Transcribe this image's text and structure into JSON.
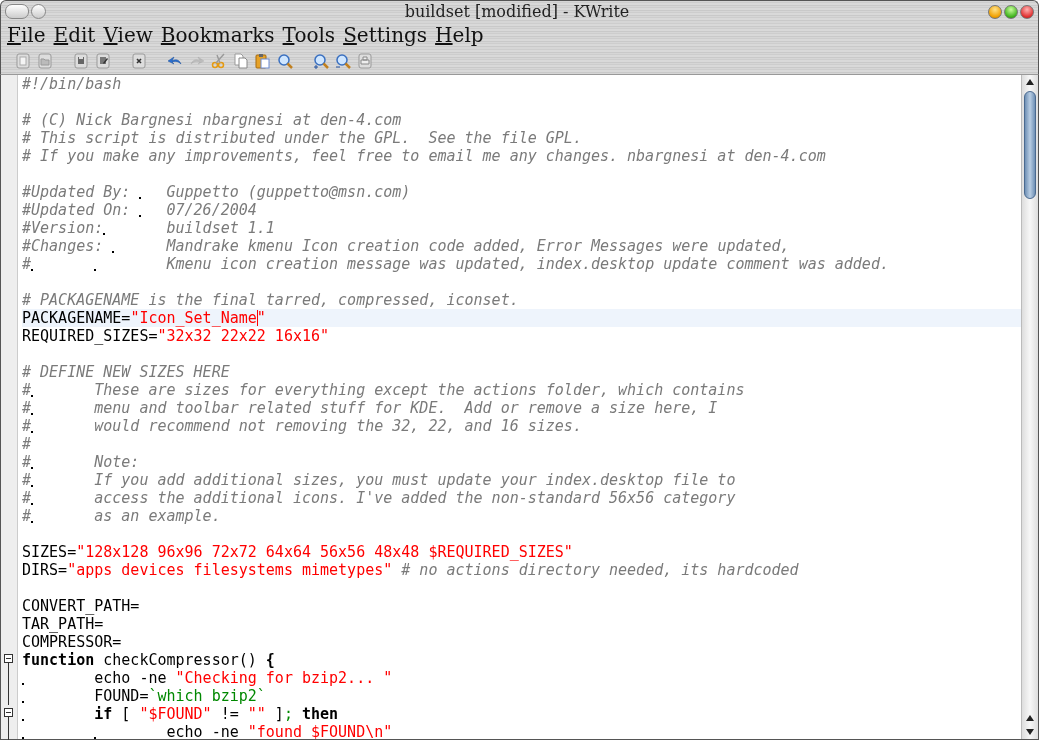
{
  "window": {
    "title": "buildset [modified] - KWrite"
  },
  "menu": [
    "File",
    "Edit",
    "View",
    "Bookmarks",
    "Tools",
    "Settings",
    "Help"
  ],
  "toolbar": [
    {
      "kind": "new",
      "disabled": false
    },
    {
      "kind": "open",
      "disabled": false
    },
    {
      "kind": "save",
      "disabled": false
    },
    {
      "kind": "saveas",
      "disabled": false
    },
    {
      "kind": "close",
      "disabled": false
    },
    {
      "kind": "undo",
      "disabled": false
    },
    {
      "kind": "redo",
      "disabled": true
    },
    {
      "kind": "cut",
      "disabled": false
    },
    {
      "kind": "copy",
      "disabled": false
    },
    {
      "kind": "paste",
      "disabled": false
    },
    {
      "kind": "find",
      "disabled": false
    },
    {
      "kind": "zoomin",
      "disabled": false
    },
    {
      "kind": "zoomout",
      "disabled": false
    },
    {
      "kind": "print",
      "disabled": false
    }
  ],
  "editor": {
    "lines": [
      {
        "current": false,
        "segments": [
          {
            "kind": "comment",
            "text": "#!/bin/bash"
          }
        ]
      },
      {
        "kind": "blank"
      },
      {
        "current": false,
        "segments": [
          {
            "kind": "comment",
            "text": "# (C) Nick Bargnesi nbargnesi at den-4.com"
          }
        ]
      },
      {
        "current": false,
        "segments": [
          {
            "kind": "comment",
            "text": "# This script is distributed under the GPL.  See the file GPL."
          }
        ]
      },
      {
        "current": false,
        "segments": [
          {
            "kind": "comment",
            "text": "# If you make any improvements, feel free to email me any changes. nbargnesi at den-4.com"
          }
        ]
      },
      {
        "kind": "blank"
      },
      {
        "current": false,
        "segments": [
          {
            "kind": "comment",
            "text": "#Updated By: \tGuppetto (guppetto@msn.com)"
          }
        ]
      },
      {
        "current": false,
        "segments": [
          {
            "kind": "comment",
            "text": "#Updated On: \t07/26/2004"
          }
        ]
      },
      {
        "current": false,
        "segments": [
          {
            "kind": "comment",
            "text": "#Version:\tbuildset 1.1"
          }
        ]
      },
      {
        "current": false,
        "segments": [
          {
            "kind": "comment",
            "text": "#Changes: \tMandrake kmenu Icon creation code added, Error Messages were updated,"
          }
        ]
      },
      {
        "current": false,
        "segments": [
          {
            "kind": "comment",
            "text": "#\t\tKmenu icon creation message was updated, index.desktop update comment was added."
          }
        ]
      },
      {
        "kind": "blank"
      },
      {
        "current": false,
        "segments": [
          {
            "kind": "comment",
            "text": "# PACKAGENAME is the final tarred, compressed, iconset."
          }
        ]
      },
      {
        "current": true,
        "segments": [
          {
            "kind": "plain",
            "text": "PACKAGENAME="
          },
          {
            "kind": "string",
            "text": "\"Icon_Set_Name"
          },
          {
            "kind": "cursor"
          },
          {
            "kind": "string",
            "text": "\""
          }
        ]
      },
      {
        "current": false,
        "segments": [
          {
            "kind": "plain",
            "text": "REQUIRED_SIZES="
          },
          {
            "kind": "string",
            "text": "\"32x32 22x22 16x16\""
          }
        ]
      },
      {
        "kind": "blank"
      },
      {
        "current": false,
        "segments": [
          {
            "kind": "comment",
            "text": "# DEFINE NEW SIZES HERE"
          }
        ]
      },
      {
        "current": false,
        "segments": [
          {
            "kind": "comment",
            "text": "#\tThese are sizes for everything except the actions folder, which contains"
          }
        ]
      },
      {
        "current": false,
        "segments": [
          {
            "kind": "comment",
            "text": "#\tmenu and toolbar related stuff for KDE.  Add or remove a size here, I"
          }
        ]
      },
      {
        "current": false,
        "segments": [
          {
            "kind": "comment",
            "text": "#\twould recommend not removing the 32, 22, and 16 sizes."
          }
        ]
      },
      {
        "current": false,
        "segments": [
          {
            "kind": "comment",
            "text": "#"
          }
        ]
      },
      {
        "current": false,
        "segments": [
          {
            "kind": "comment",
            "text": "#\tNote:"
          }
        ]
      },
      {
        "current": false,
        "segments": [
          {
            "kind": "comment",
            "text": "#\tIf you add additional sizes, you must update your index.desktop file to"
          }
        ]
      },
      {
        "current": false,
        "segments": [
          {
            "kind": "comment",
            "text": "#\taccess the additional icons. I've added the non-standard 56x56 category"
          }
        ]
      },
      {
        "current": false,
        "segments": [
          {
            "kind": "comment",
            "text": "#\tas an example."
          }
        ]
      },
      {
        "kind": "blank"
      },
      {
        "current": false,
        "segments": [
          {
            "kind": "plain",
            "text": "SIZES="
          },
          {
            "kind": "string",
            "text": "\"128x128 96x96 72x72 64x64 56x56 48x48 $REQUIRED_SIZES\""
          }
        ]
      },
      {
        "current": false,
        "segments": [
          {
            "kind": "plain",
            "text": "DIRS="
          },
          {
            "kind": "string",
            "text": "\"apps devices filesystems mimetypes\""
          },
          {
            "kind": "comment",
            "text": " # no actions directory needed, its hardcoded"
          }
        ]
      },
      {
        "kind": "blank"
      },
      {
        "current": false,
        "segments": [
          {
            "kind": "plain",
            "text": "CONVERT_PATH="
          }
        ]
      },
      {
        "current": false,
        "segments": [
          {
            "kind": "plain",
            "text": "TAR_PATH="
          }
        ]
      },
      {
        "current": false,
        "segments": [
          {
            "kind": "plain",
            "text": "COMPRESSOR="
          }
        ]
      },
      {
        "fold_toggle": true,
        "fold_line": true,
        "current": false,
        "segments": [
          {
            "kind": "keyword",
            "text": "function"
          },
          {
            "kind": "plain",
            "text": " checkCompressor() "
          },
          {
            "kind": "keyword",
            "text": "{"
          }
        ]
      },
      {
        "fold_toggle": false,
        "fold_line": true,
        "current": false,
        "segments": [
          {
            "kind": "plain",
            "text": "\techo -ne "
          },
          {
            "kind": "string",
            "text": "\"Checking for bzip2... \""
          }
        ]
      },
      {
        "fold_toggle": false,
        "fold_line": true,
        "current": false,
        "segments": [
          {
            "kind": "plain",
            "text": "\tFOUND="
          },
          {
            "kind": "command",
            "text": "`which bzip2`"
          }
        ]
      },
      {
        "fold_toggle": true,
        "fold_line": true,
        "current": false,
        "segments": [
          {
            "kind": "keyword",
            "text": "\tif"
          },
          {
            "kind": "plain",
            "text": " [ "
          },
          {
            "kind": "string",
            "text": "\"$FOUND\""
          },
          {
            "kind": "plain",
            "text": " != "
          },
          {
            "kind": "string",
            "text": "\"\""
          },
          {
            "kind": "plain",
            "text": " ]"
          },
          {
            "kind": "command",
            "text": ";"
          },
          {
            "kind": "keyword",
            "text": " then"
          }
        ]
      },
      {
        "fold_toggle": false,
        "fold_line": true,
        "current": false,
        "segments": [
          {
            "kind": "plain",
            "text": "\t\techo -ne "
          },
          {
            "kind": "string",
            "text": "\"found $FOUND\\n\""
          }
        ]
      }
    ]
  }
}
